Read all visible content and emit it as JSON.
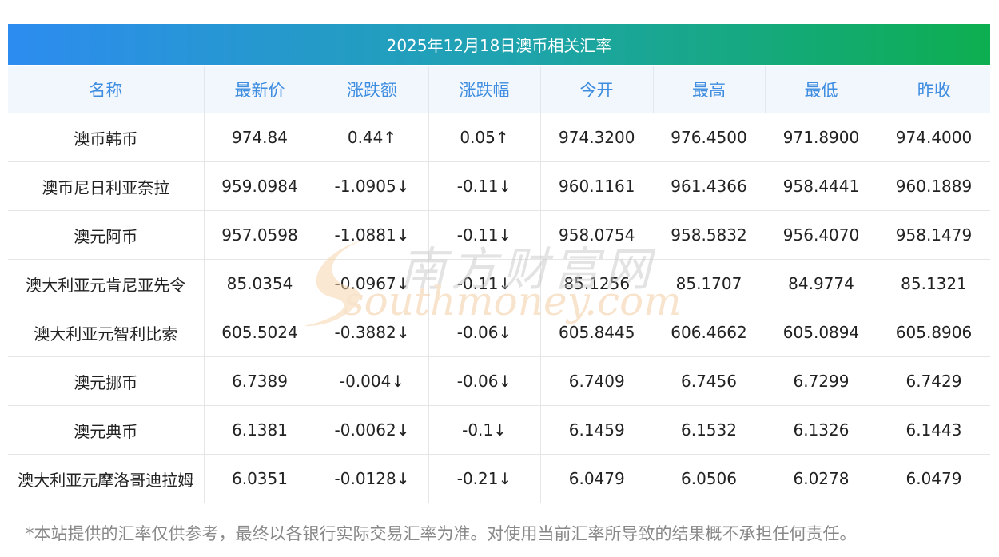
{
  "title": "2025年12月18日澳币相关汇率",
  "columns": [
    "名称",
    "最新价",
    "涨跌额",
    "涨跌幅",
    "今开",
    "最高",
    "最低",
    "昨收"
  ],
  "rows": [
    {
      "name": "澳币韩币",
      "latest": "974.84",
      "change": "0.44↑",
      "pct": "0.05↑",
      "open": "974.3200",
      "high": "976.4500",
      "low": "971.8900",
      "prev": "974.4000",
      "dir": "up"
    },
    {
      "name": "澳币尼日利亚奈拉",
      "latest": "959.0984",
      "change": "-1.0905↓",
      "pct": "-0.11↓",
      "open": "960.1161",
      "high": "961.4366",
      "low": "958.4441",
      "prev": "960.1889",
      "dir": "down"
    },
    {
      "name": "澳元阿币",
      "latest": "957.0598",
      "change": "-1.0881↓",
      "pct": "-0.11↓",
      "open": "958.0754",
      "high": "958.5832",
      "low": "956.4070",
      "prev": "958.1479",
      "dir": "down"
    },
    {
      "name": "澳大利亚元肯尼亚先令",
      "latest": "85.0354",
      "change": "-0.0967↓",
      "pct": "-0.11↓",
      "open": "85.1256",
      "high": "85.1707",
      "low": "84.9774",
      "prev": "85.1321",
      "dir": "down"
    },
    {
      "name": "澳大利亚元智利比索",
      "latest": "605.5024",
      "change": "-0.3882↓",
      "pct": "-0.06↓",
      "open": "605.8445",
      "high": "606.4662",
      "low": "605.0894",
      "prev": "605.8906",
      "dir": "down"
    },
    {
      "name": "澳元挪币",
      "latest": "6.7389",
      "change": "-0.004↓",
      "pct": "-0.06↓",
      "open": "6.7409",
      "high": "6.7456",
      "low": "6.7299",
      "prev": "6.7429",
      "dir": "down"
    },
    {
      "name": "澳元典币",
      "latest": "6.1381",
      "change": "-0.0062↓",
      "pct": "-0.1↓",
      "open": "6.1459",
      "high": "6.1532",
      "low": "6.1326",
      "prev": "6.1443",
      "dir": "down"
    },
    {
      "name": "澳大利亚元摩洛哥迪拉姆",
      "latest": "6.0351",
      "change": "-0.0128↓",
      "pct": "-0.21↓",
      "open": "6.0479",
      "high": "6.0506",
      "low": "6.0278",
      "prev": "6.0479",
      "dir": "down"
    }
  ],
  "watermark": {
    "cn": "南方财富网",
    "en": "southmoney.com"
  },
  "footer": "*本站提供的汇率仅供参考，最终以各银行实际交易汇率为准。对使用当前汇率所导致的结果概不承担任何责任。",
  "colors": {
    "up": "#e60012",
    "down": "#1a8a1a",
    "header_text": "#3e8de0",
    "banner_start": "#2d8cf0",
    "banner_end": "#0dae50"
  }
}
